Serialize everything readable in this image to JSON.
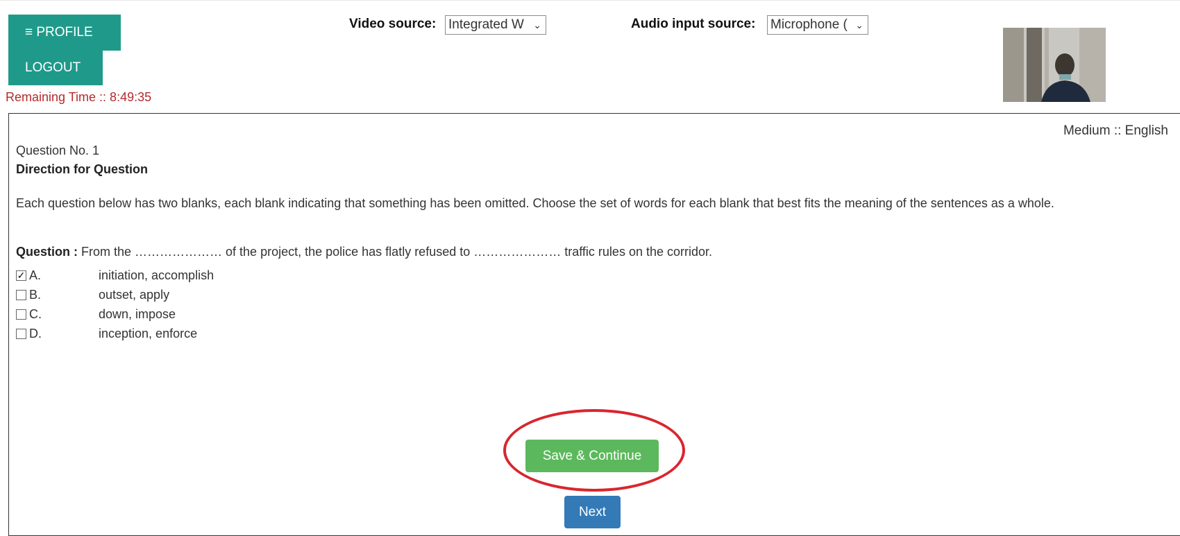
{
  "header": {
    "profile_label": "≡ PROFILE",
    "logout_label": "LOGOUT",
    "remaining_time": "Remaining Time :: 8:49:35",
    "video_source_label": "Video source:",
    "video_source_value": "Integrated W",
    "audio_source_label": "Audio input source:",
    "audio_source_value": "Microphone (",
    "dropdown_chevron": "⌄"
  },
  "question_panel": {
    "medium": "Medium ::  English",
    "question_no": "Question No. 1",
    "direction_title": "Direction for Question",
    "direction_text": "Each question below has two blanks, each blank indicating that something has been omitted. Choose the set of words for each blank that best fits the meaning of the sentences as a whole.",
    "question_label": "Question :",
    "question_text": "From the  ………………… of the project, the police has flatly refused to ………………… traffic rules on the corridor.",
    "options": [
      {
        "letter": "A.",
        "text": "initiation, accomplish",
        "checked": true
      },
      {
        "letter": "B.",
        "text": "outset, apply",
        "checked": false
      },
      {
        "letter": "C.",
        "text": "down, impose",
        "checked": false
      },
      {
        "letter": "D.",
        "text": "inception, enforce",
        "checked": false
      }
    ]
  },
  "actions": {
    "save_label": "Save & Continue",
    "next_label": "Next"
  },
  "colors": {
    "teal": "#1f9a8a",
    "timer_red": "#b52a2a",
    "save_green": "#5cb85c",
    "next_blue": "#337ab7",
    "highlight_circle": "#d8262e"
  }
}
